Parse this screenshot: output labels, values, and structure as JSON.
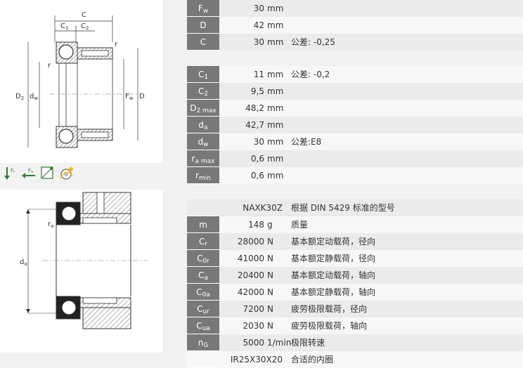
{
  "top_drawing": {
    "labels": {
      "C": "C",
      "C1": "C",
      "C1_sub": "1",
      "C2": "C",
      "C2_sub": "2",
      "r1": "r",
      "r2": "r",
      "D2": "D",
      "D2_sub": "2",
      "dw": "d",
      "dw_sub": "w",
      "Fw": "F",
      "Fw_sub": "w",
      "D": "D"
    }
  },
  "bottom_drawing": {
    "labels": {
      "ra": "r",
      "ra_sub": "a",
      "da": "d",
      "da_sub": "a"
    }
  },
  "toolbar": {
    "icons": [
      "Fr-force-icon",
      "Fa-force-icon",
      "mounting-icon",
      "lubrication-icon"
    ],
    "fr": "F",
    "fr_sub": "r",
    "fa": "F",
    "fa_sub": "a"
  },
  "table": {
    "rows": [
      {
        "sym": "F",
        "sub": "w",
        "val": "30",
        "unit": "mm",
        "desc": ""
      },
      {
        "sym": "D",
        "sub": "",
        "val": "42",
        "unit": "mm",
        "desc": ""
      },
      {
        "sym": "C",
        "sub": "",
        "val": "30",
        "unit": "mm",
        "desc": "公差: -0,25"
      },
      {
        "sym": "C",
        "sub": "1",
        "val": "11",
        "unit": "mm",
        "desc": "公差: -0,2"
      },
      {
        "sym": "C",
        "sub": "2",
        "val": "9,5",
        "unit": "mm",
        "desc": ""
      },
      {
        "sym": "D",
        "sub": "2 max",
        "val": "48,2",
        "unit": "mm",
        "desc": ""
      },
      {
        "sym": "d",
        "sub": "a",
        "val": "42,7",
        "unit": "mm",
        "desc": ""
      },
      {
        "sym": "d",
        "sub": "w",
        "val": "30",
        "unit": "mm",
        "desc": "公差:E8"
      },
      {
        "sym": "r",
        "sub": "a max",
        "val": "0,6",
        "unit": "mm",
        "desc": ""
      },
      {
        "sym": "r",
        "sub": "min",
        "val": "0,6",
        "unit": "mm",
        "desc": ""
      },
      {
        "sym": "",
        "sub": "",
        "val": "NAXK30Z",
        "unit": "",
        "desc": "根据  DIN 5429 标准的型号"
      },
      {
        "sym": "m",
        "sub": "",
        "val": "148",
        "unit": "g",
        "desc": "质量"
      },
      {
        "sym": "C",
        "sub": "r",
        "val": "28000",
        "unit": "N",
        "desc": "基本额定动载荷，径向"
      },
      {
        "sym": "C",
        "sub": "0r",
        "val": "41000",
        "unit": "N",
        "desc": "基本额定静载荷，径向"
      },
      {
        "sym": "C",
        "sub": "a",
        "val": "20400",
        "unit": "N",
        "desc": "基本额定动载荷，轴向"
      },
      {
        "sym": "C",
        "sub": "0a",
        "val": "42000",
        "unit": "N",
        "desc": "基本额定静载荷，轴向"
      },
      {
        "sym": "C",
        "sub": "ur",
        "val": "7200",
        "unit": "N",
        "desc": "疲劳极限载荷，径向"
      },
      {
        "sym": "C",
        "sub": "ua",
        "val": "2030",
        "unit": "N",
        "desc": "疲劳极限载荷，轴向"
      },
      {
        "sym": "n",
        "sub": "G",
        "val": "5000",
        "unit": "1/min",
        "desc": "极限转速"
      },
      {
        "sym": "",
        "sub": "",
        "val": "IR25X30X20",
        "unit": "",
        "desc": "合适的内圈"
      }
    ]
  }
}
